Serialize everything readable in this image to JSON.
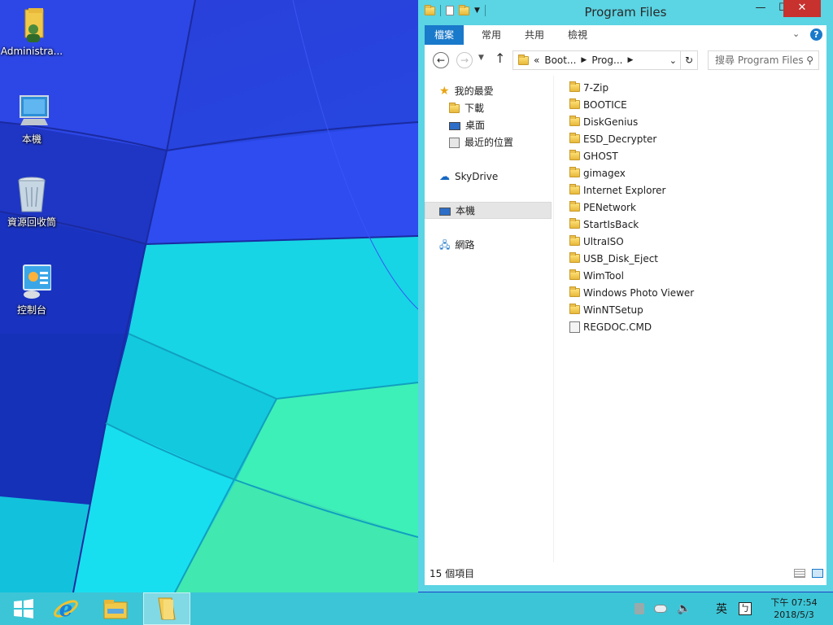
{
  "desktop": {
    "icons": [
      {
        "label": "Administra...",
        "icon": "user-folder-icon"
      },
      {
        "label": "本機",
        "icon": "computer-icon"
      },
      {
        "label": "資源回收筒",
        "icon": "recycle-bin-icon"
      },
      {
        "label": "控制台",
        "icon": "control-panel-icon"
      }
    ]
  },
  "window": {
    "title": "Program Files",
    "controls": {
      "minimize": "—",
      "maximize": "☐",
      "close": "✕"
    },
    "ribbon_tabs": [
      {
        "label": "檔案",
        "active": true
      },
      {
        "label": "常用",
        "active": false
      },
      {
        "label": "共用",
        "active": false
      },
      {
        "label": "檢視",
        "active": false
      }
    ],
    "address": {
      "prefix": "«",
      "crumbs": [
        "Boot...",
        "Prog..."
      ],
      "search_placeholder": "搜尋 Program Files"
    },
    "nav": {
      "favorites_label": "我的最愛",
      "favorites": [
        "下載",
        "桌面",
        "最近的位置"
      ],
      "skydrive": "SkyDrive",
      "thispc": "本機",
      "network": "網路"
    },
    "files": [
      {
        "name": "7-Zip",
        "type": "folder"
      },
      {
        "name": "BOOTICE",
        "type": "folder"
      },
      {
        "name": "DiskGenius",
        "type": "folder"
      },
      {
        "name": "ESD_Decrypter",
        "type": "folder"
      },
      {
        "name": "GHOST",
        "type": "folder"
      },
      {
        "name": "gimagex",
        "type": "folder"
      },
      {
        "name": "Internet Explorer",
        "type": "folder"
      },
      {
        "name": "PENetwork",
        "type": "folder"
      },
      {
        "name": "StartIsBack",
        "type": "folder"
      },
      {
        "name": "UltraISO",
        "type": "folder"
      },
      {
        "name": "USB_Disk_Eject",
        "type": "folder"
      },
      {
        "name": "WimTool",
        "type": "folder"
      },
      {
        "name": "Windows Photo Viewer",
        "type": "folder"
      },
      {
        "name": "WinNTSetup",
        "type": "folder"
      },
      {
        "name": "REGDOC.CMD",
        "type": "cmd"
      }
    ],
    "status": "15 個項目"
  },
  "taskbar": {
    "ime_lang": "英",
    "ime_mode": "ㄅ",
    "time": "下午 07:54",
    "date": "2018/5/3"
  },
  "colors": {
    "accent": "#1979ca",
    "window_frame": "#5bd4e3",
    "taskbar": "#3cc5d6",
    "close": "#c7312e"
  }
}
